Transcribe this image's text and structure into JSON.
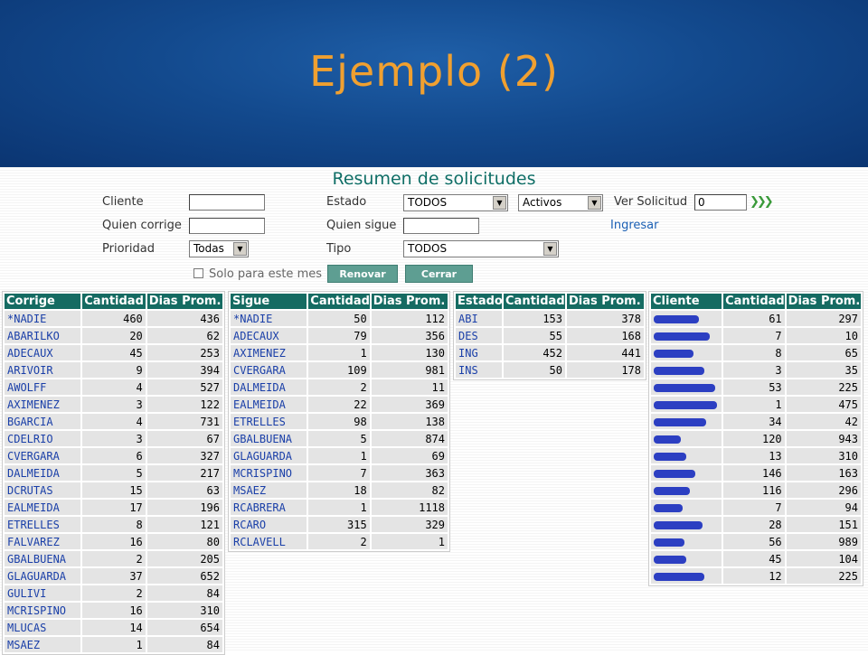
{
  "slide": {
    "title": "Ejemplo (2)"
  },
  "app": {
    "title": "Resumen de solicitudes",
    "filters": {
      "cliente_label": "Cliente",
      "cliente_value": "",
      "estado_label": "Estado",
      "estado_value": "TODOS",
      "activos_value": "Activos",
      "ver_solicitud_label": "Ver Solicitud",
      "ver_solicitud_value": "0",
      "quien_corrige_label": "Quien corrige",
      "quien_corrige_value": "",
      "quien_sigue_label": "Quien sigue",
      "quien_sigue_value": "",
      "ingresar_label": "Ingresar",
      "prioridad_label": "Prioridad",
      "prioridad_value": "Todas",
      "tipo_label": "Tipo",
      "tipo_value": "TODOS",
      "solo_label": "Solo para este mes",
      "renovar_label": "Renovar",
      "cerrar_label": "Cerrar",
      "go_glyph": "❯❯❯"
    }
  },
  "tables": {
    "corrige": {
      "headers": [
        "Corrige",
        "Cantidad",
        "Dias Prom."
      ],
      "rows": [
        [
          "*NADIE",
          "460",
          "436"
        ],
        [
          "ABARILKO",
          "20",
          "62"
        ],
        [
          "ADECAUX",
          "45",
          "253"
        ],
        [
          "ARIVOIR",
          "9",
          "394"
        ],
        [
          "AWOLFF",
          "4",
          "527"
        ],
        [
          "AXIMENEZ",
          "3",
          "122"
        ],
        [
          "BGARCIA",
          "4",
          "731"
        ],
        [
          "CDELRIO",
          "3",
          "67"
        ],
        [
          "CVERGARA",
          "6",
          "327"
        ],
        [
          "DALMEIDA",
          "5",
          "217"
        ],
        [
          "DCRUTAS",
          "15",
          "63"
        ],
        [
          "EALMEIDA",
          "17",
          "196"
        ],
        [
          "ETRELLES",
          "8",
          "121"
        ],
        [
          "FALVAREZ",
          "16",
          "80"
        ],
        [
          "GBALBUENA",
          "2",
          "205"
        ],
        [
          "GLAGUARDA",
          "37",
          "652"
        ],
        [
          "GULIVI",
          "2",
          "84"
        ],
        [
          "MCRISPINO",
          "16",
          "310"
        ],
        [
          "MLUCAS",
          "14",
          "654"
        ],
        [
          "MSAEZ",
          "1",
          "84"
        ]
      ]
    },
    "sigue": {
      "headers": [
        "Sigue",
        "Cantidad",
        "Dias Prom."
      ],
      "rows": [
        [
          "*NADIE",
          "50",
          "112"
        ],
        [
          "ADECAUX",
          "79",
          "356"
        ],
        [
          "AXIMENEZ",
          "1",
          "130"
        ],
        [
          "CVERGARA",
          "109",
          "981"
        ],
        [
          "DALMEIDA",
          "2",
          "11"
        ],
        [
          "EALMEIDA",
          "22",
          "369"
        ],
        [
          "ETRELLES",
          "98",
          "138"
        ],
        [
          "GBALBUENA",
          "5",
          "874"
        ],
        [
          "GLAGUARDA",
          "1",
          "69"
        ],
        [
          "MCRISPINO",
          "7",
          "363"
        ],
        [
          "MSAEZ",
          "18",
          "82"
        ],
        [
          "RCABRERA",
          "1",
          "1118"
        ],
        [
          "RCARO",
          "315",
          "329"
        ],
        [
          "RCLAVELL",
          "2",
          "1"
        ]
      ]
    },
    "estado": {
      "headers": [
        "Estado",
        "Cantidad",
        "Dias Prom."
      ],
      "rows": [
        [
          "ABI",
          "153",
          "378"
        ],
        [
          "DES",
          "55",
          "168"
        ],
        [
          "ING",
          "452",
          "441"
        ],
        [
          "INS",
          "50",
          "178"
        ]
      ]
    },
    "cliente": {
      "headers": [
        "Cliente",
        "Cantidad",
        "Dias Prom."
      ],
      "redaction_color": "#2c3fc2",
      "rows": [
        [
          "61",
          "297"
        ],
        [
          "7",
          "10"
        ],
        [
          "8",
          "65"
        ],
        [
          "3",
          "35"
        ],
        [
          "53",
          "225"
        ],
        [
          "1",
          "475"
        ],
        [
          "34",
          "42"
        ],
        [
          "120",
          "943"
        ],
        [
          "13",
          "310"
        ],
        [
          "146",
          "163"
        ],
        [
          "116",
          "296"
        ],
        [
          "7",
          "94"
        ],
        [
          "28",
          "151"
        ],
        [
          "56",
          "989"
        ],
        [
          "45",
          "104"
        ],
        [
          "12",
          "225"
        ]
      ]
    }
  }
}
